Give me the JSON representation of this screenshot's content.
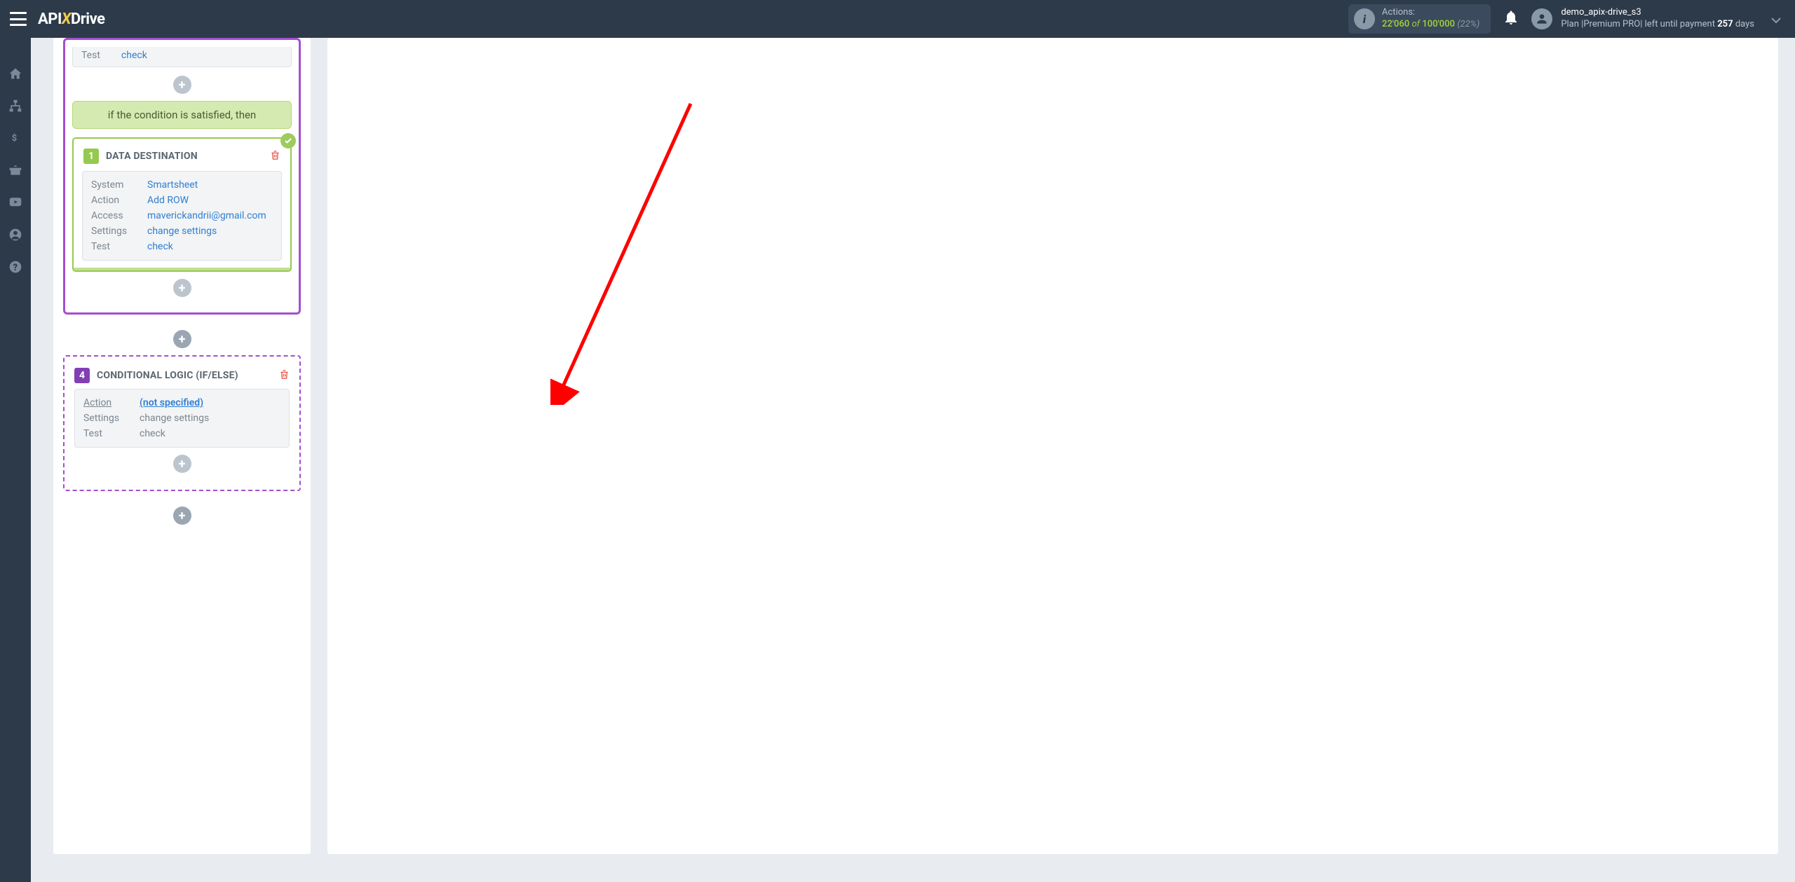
{
  "header": {
    "logo": {
      "api": "API",
      "x": "X",
      "drive": "Drive"
    },
    "actions": {
      "label": "Actions:",
      "current": "22'060",
      "of": "of",
      "total": "100'000",
      "pct": "(22%)"
    },
    "user": {
      "name": "demo_apix-drive_s3",
      "plan_prefix": "Plan |",
      "plan_name": "Premium PRO",
      "plan_suffix": "| left until payment",
      "days": "257",
      "days_suffix": "days"
    }
  },
  "partial_row": {
    "label": "Test",
    "value": "check"
  },
  "condition_bar": "if the condition is satisfied, then",
  "destination": {
    "num": "1",
    "title": "DATA DESTINATION",
    "rows": {
      "system": {
        "label": "System",
        "value": "Smartsheet"
      },
      "action": {
        "label": "Action",
        "value": "Add ROW"
      },
      "access": {
        "label": "Access",
        "value": "maverickandrii@gmail.com"
      },
      "settings": {
        "label": "Settings",
        "value": "change settings"
      },
      "test": {
        "label": "Test",
        "value": "check"
      }
    }
  },
  "conditional": {
    "num": "4",
    "title": "CONDITIONAL LOGIC (IF/ELSE)",
    "rows": {
      "action": {
        "label": "Action",
        "value": "(not specified)"
      },
      "settings": {
        "label": "Settings",
        "value": "change settings"
      },
      "test": {
        "label": "Test",
        "value": "check"
      }
    }
  }
}
